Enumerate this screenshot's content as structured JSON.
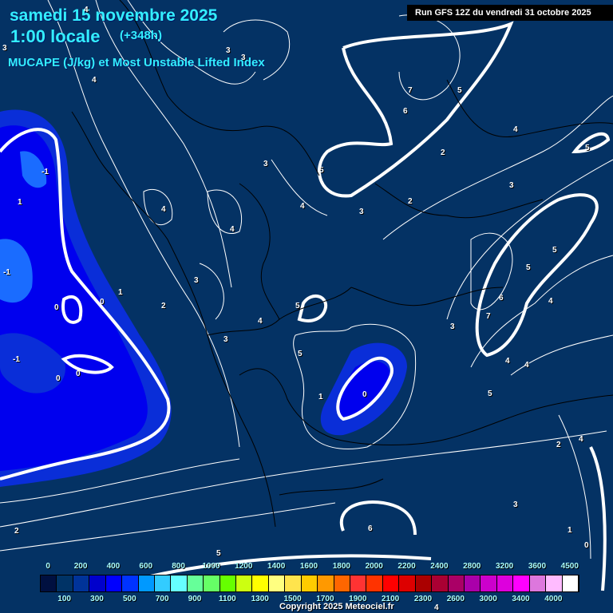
{
  "header": {
    "date": "samedi 15 novembre 2025",
    "time": "1:00 locale",
    "lead": "(+348h)",
    "parameter": "MUCAPE (J/kg) et Most Unstable Lifted Index",
    "run": "Run GFS 12Z du vendredi 31 octobre 2025"
  },
  "contour_labels": [
    "3",
    "4",
    "4",
    "3",
    "3",
    "7",
    "5",
    "6",
    "5",
    "4",
    "2",
    "5",
    "3",
    "-1",
    "1",
    "3",
    "4",
    "4",
    "4",
    "2",
    "3",
    "5",
    "-1",
    "0",
    "1",
    "2",
    "3",
    "3",
    "5",
    "6",
    "7",
    "4",
    "5",
    "0",
    "-1",
    "0",
    "0",
    "4",
    "3",
    "5",
    "1",
    "0",
    "4",
    "4",
    "5",
    "2",
    "4",
    "3",
    "6",
    "1",
    "0",
    "2",
    "5",
    "4"
  ],
  "legend": {
    "colors": [
      "#001040",
      "#003366",
      "#003399",
      "#0000cc",
      "#0000ff",
      "#0033ff",
      "#0099ff",
      "#33ccff",
      "#66ffff",
      "#66ff99",
      "#66ff66",
      "#66ff00",
      "#ccff11",
      "#ffff00",
      "#ffff80",
      "#ffe44d",
      "#ffcc00",
      "#ff9900",
      "#ff6600",
      "#ff3333",
      "#ff3300",
      "#ff0000",
      "#dd0000",
      "#aa0000",
      "#aa0033",
      "#aa0066",
      "#aa00aa",
      "#cc00cc",
      "#dd00dd",
      "#ff00ff",
      "#dd77dd",
      "#ffbbff",
      "#ffffff"
    ],
    "top_labels": [
      "0",
      "200",
      "400",
      "600",
      "800",
      "1000",
      "1200",
      "1400",
      "1600",
      "1800",
      "2000",
      "2200",
      "2400",
      "2800",
      "3200",
      "3600",
      "4500"
    ],
    "bottom_labels": [
      "100",
      "300",
      "500",
      "700",
      "900",
      "1100",
      "1300",
      "1500",
      "1700",
      "1900",
      "2100",
      "2300",
      "2600",
      "3000",
      "3400",
      "4000"
    ]
  },
  "copyright": "Copyright 2025 Meteociel.fr"
}
